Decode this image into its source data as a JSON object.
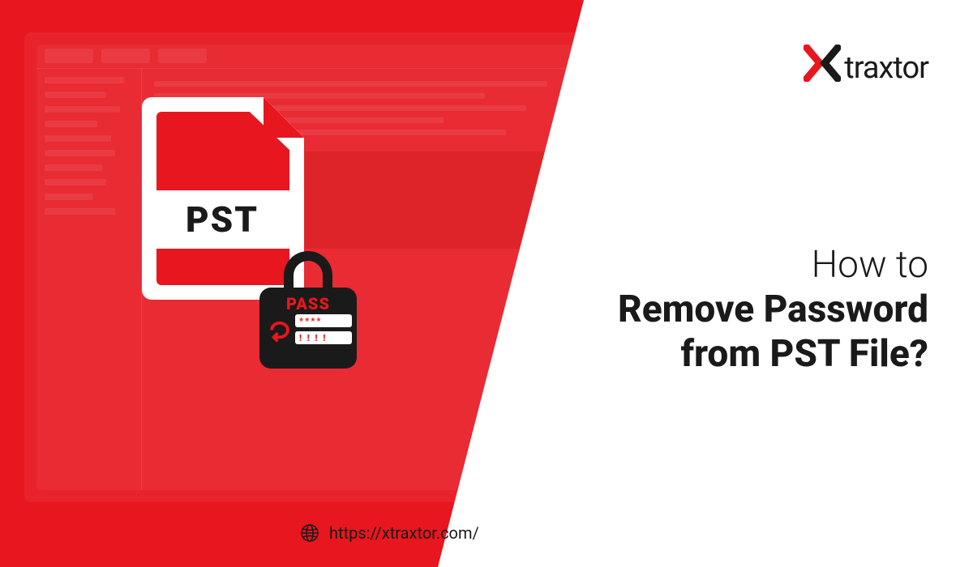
{
  "logo": {
    "brand_text": "traxtor"
  },
  "headline": {
    "line1": "How to",
    "line2": "Remove Password",
    "line3": "from PST File?"
  },
  "file_icon": {
    "label": "PST"
  },
  "lock": {
    "pass_label": "PASS",
    "field_stars": "****",
    "field_bangs": "! ! ! !"
  },
  "url": "https://xtraxtor.com/",
  "colors": {
    "red": "#e8161e",
    "dark": "#1a1a1a",
    "white": "#ffffff"
  }
}
